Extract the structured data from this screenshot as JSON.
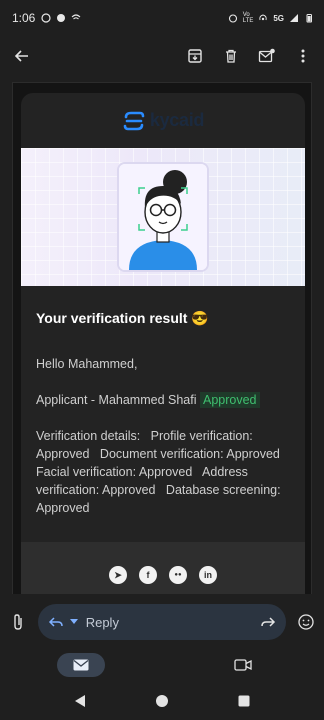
{
  "status_bar": {
    "time": "1:06",
    "network": "5G",
    "icons": [
      "whatsapp-icon",
      "messenger-icon",
      "wifi-calling-icon",
      "alarm-icon",
      "volte-icon",
      "hotspot-icon",
      "signal-icon",
      "battery-icon"
    ]
  },
  "app_bar": {
    "actions": [
      "archive-icon",
      "delete-icon",
      "mark-unread-icon",
      "more-icon"
    ]
  },
  "email": {
    "brand": "kycaid",
    "title": "Your verification result",
    "title_emoji": "😎",
    "greeting": "Hello Mahammed,",
    "applicant_prefix": "Applicant - Mahammed Shafi",
    "applicant_status": "Approved",
    "details": "Verification details:   Profile verification: Approved   Document verification: Approved   Facial verification: Approved   Address verification: Approved   Database screening: Approved",
    "social": [
      {
        "name": "telegram-icon",
        "glyph": "➤"
      },
      {
        "name": "facebook-icon",
        "glyph": "f"
      },
      {
        "name": "medium-icon",
        "glyph": "●●"
      },
      {
        "name": "linkedin-icon",
        "glyph": "in"
      }
    ]
  },
  "reply_bar": {
    "reply_label": "Reply"
  },
  "colors": {
    "background": "#1f1f1f",
    "card": "#232323",
    "approved_text": "#3fbf6f",
    "approved_bg": "#1f3a2a",
    "accent_blue": "#1a8cff"
  }
}
